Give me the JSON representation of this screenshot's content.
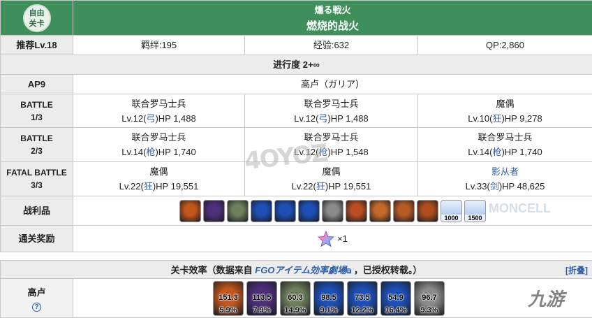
{
  "quest": {
    "badge_line1": "自由",
    "badge_line2": "关卡",
    "title_jp": "燻る戦火",
    "title_cn": "燃烧的战火"
  },
  "info": {
    "level": "推荐Lv.18",
    "bond": "羁绊:195",
    "exp": "经验:632",
    "qp": "QP:2,860"
  },
  "progress": "进行度 2+∞",
  "ap": {
    "label": "AP9",
    "location": "高卢（ガリア）"
  },
  "battles": [
    {
      "label_top": "BATTLE",
      "label_bottom": "1/3",
      "enemies": [
        {
          "name": "联合罗马士兵",
          "lv": "Lv.12(",
          "cls": "弓",
          "hp": ")HP 1,488"
        },
        {
          "name": "联合罗马士兵",
          "lv": "Lv.12(",
          "cls": "弓",
          "hp": ")HP 1,488"
        },
        {
          "name": "魔偶",
          "lv": "Lv.10(",
          "cls": "狂",
          "hp": ")HP 9,278"
        }
      ]
    },
    {
      "label_top": "BATTLE",
      "label_bottom": "2/3",
      "enemies": [
        {
          "name": "联合罗马士兵",
          "lv": "Lv.14(",
          "cls": "枪",
          "hp": ")HP 1,740"
        },
        {
          "name": "联合罗马士兵",
          "lv": "Lv.12(",
          "cls": "枪",
          "hp": ")HP 1,548"
        },
        {
          "name": "联合罗马士兵",
          "lv": "Lv.14(",
          "cls": "枪",
          "hp": ")HP 1,740"
        }
      ]
    },
    {
      "label_top": "FATAL BATTLE",
      "label_bottom": "3/3",
      "enemies": [
        {
          "name": "魔偶",
          "lv": "Lv.22(",
          "cls": "狂",
          "hp": ")HP 19,551"
        },
        {
          "name": "魔偶",
          "lv": "Lv.22(",
          "cls": "狂",
          "hp": ")HP 19,551"
        },
        {
          "name": "影从者",
          "lv": "Lv.33(",
          "cls": "剑",
          "hp": ")HP 48,625"
        }
      ]
    }
  ],
  "drops": {
    "label": "战利品",
    "items": [
      {
        "icon": "fire-gem-icon",
        "color": "#c2561b",
        "count": ""
      },
      {
        "icon": "purple-crystal-icon",
        "color": "#4d2f7a",
        "count": ""
      },
      {
        "icon": "green-ring-icon",
        "color": "#6d7f5c",
        "count": ""
      },
      {
        "icon": "blue-gem-icon",
        "color": "#1d4fb5",
        "count": ""
      },
      {
        "icon": "blue-gem-icon",
        "color": "#1d4fb5",
        "count": ""
      },
      {
        "icon": "blue-gem-icon",
        "color": "#1d4fb5",
        "count": ""
      },
      {
        "icon": "chess-piece-icon",
        "color": "#8a8a8a",
        "count": ""
      },
      {
        "icon": "fire-gem-icon",
        "color": "#b84e22",
        "count": ""
      },
      {
        "icon": "fire-gem-icon",
        "color": "#c36a2a",
        "count": ""
      },
      {
        "icon": "fire-gem-icon",
        "color": "#b85a26",
        "count": ""
      },
      {
        "icon": "fire-gem-icon",
        "color": "#b04d1e",
        "count": ""
      },
      {
        "icon": "qp-crystal-icon",
        "color": "#8fb0d8",
        "count": "1000"
      },
      {
        "icon": "qp-crystal-icon",
        "color": "#8fb0d8",
        "count": "1500"
      }
    ]
  },
  "reward": {
    "label": "通关奖励",
    "icon": "saint-quartz-icon",
    "count": "×1"
  },
  "efficiency": {
    "head_prefix": "关卡效率（数据来自",
    "source": "FGOアイテム効率劇場",
    "source_icon": "external-link-icon",
    "head_suffix": "，已授权转载。）",
    "fold": "[折叠]",
    "row_label": "高卢",
    "help": "?",
    "items": [
      {
        "icon": "fire-gem-icon",
        "color": "#c2561b",
        "v1": "151.3",
        "v2": "5.9%"
      },
      {
        "icon": "purple-crystal-icon",
        "color": "#4d2f7a",
        "v1": "113.5",
        "v2": "7.9%"
      },
      {
        "icon": "green-ring-icon",
        "color": "#6d7f5c",
        "v1": "60.3",
        "v2": "14.9%"
      },
      {
        "icon": "blue-gem-icon",
        "color": "#1d4fb5",
        "v1": "98.5",
        "v2": "9.1%"
      },
      {
        "icon": "blue-gem-icon",
        "color": "#1d4fb5",
        "v1": "73.5",
        "v2": "12.2%"
      },
      {
        "icon": "blue-gem-icon",
        "color": "#1d4fb5",
        "v1": "54.9",
        "v2": "16.4%"
      },
      {
        "icon": "chess-piece-icon",
        "color": "#8a8a8a",
        "v1": "96.7",
        "v2": "9.3%"
      }
    ]
  },
  "watermarks": {
    "w1": "4OYOZ",
    "w2": "MONCELL",
    "w3": "九游"
  }
}
